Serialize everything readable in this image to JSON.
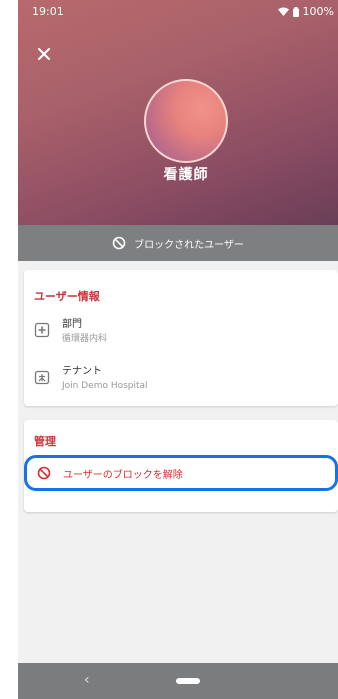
{
  "status": {
    "time": "19:01",
    "battery": "100%"
  },
  "profile": {
    "name": "看護師"
  },
  "blocked_banner": {
    "text": "ブロックされたユーザー"
  },
  "user_info": {
    "title": "ユーザー情報",
    "rows": [
      {
        "icon": "department-icon",
        "label": "部門",
        "value": "循環器内科"
      },
      {
        "icon": "tenant-icon",
        "label": "テナント",
        "value": "Join Demo Hospital"
      }
    ]
  },
  "admin": {
    "title": "管理",
    "unblock_label": "ユーザーのブロックを解除"
  },
  "colors": {
    "accent_red": "#c8353c",
    "focus_blue": "#1673e6",
    "banner_gray": "#7d7f81"
  }
}
